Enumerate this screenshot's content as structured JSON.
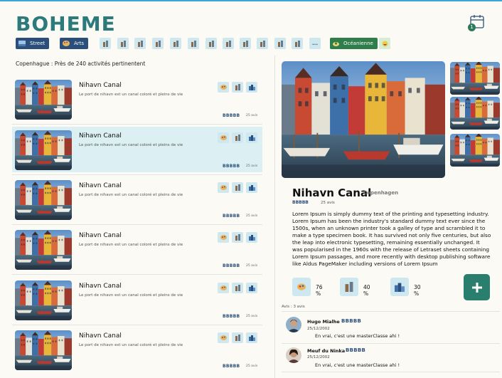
{
  "app": {
    "logo": "BOHEME"
  },
  "header": {
    "calendar_badge": "1"
  },
  "filters": {
    "street_label": "Street",
    "arts_label": "Arts",
    "more_label": "...",
    "oceanienne_label": "Océanienne"
  },
  "results": {
    "title": "Copenhague : Près de 240 activités pertinentent",
    "items": [
      {
        "name": "Nihavn Canal",
        "desc": "Le port de nihavn est un canal coloré et pleins de vie",
        "stars": "BBBBB",
        "reviews": "25 avis"
      },
      {
        "name": "Nihavn Canal",
        "desc": "Le port de nihavn est un canal coloré et pleins de vie",
        "stars": "BBBBB",
        "reviews": "25 avis"
      },
      {
        "name": "Nihavn Canal",
        "desc": "Le port de nihavn est un canal coloré et pleins de vie",
        "stars": "BBBBB",
        "reviews": "25 avis"
      },
      {
        "name": "Nihavn Canal",
        "desc": "Le port de nihavn est un canal coloré et pleins de vie",
        "stars": "BBBBB",
        "reviews": "25 avis"
      },
      {
        "name": "Nihavn Canal",
        "desc": "Le port de nihavn est un canal coloré et pleins de vie",
        "stars": "BBBBB",
        "reviews": "25 avis"
      },
      {
        "name": "Nihavn Canal",
        "desc": "Le port de nihavn est un canal coloré et pleins de vie",
        "stars": "BBBBB",
        "reviews": "25 avis"
      }
    ]
  },
  "detail": {
    "name": "Nihavn Canal",
    "city": "Copenhagen",
    "stars": "BBBBB",
    "reviews": "25 avis",
    "description": "Lorem Ipsum is simply dummy text of the printing and typesetting industry. Lorem Ipsum has been the industry's standard dummy text ever since the 1500s, when an unknown printer took a galley of type and scrambled it to make a type specimen book. It has survived not only five centuries, but also the leap into electronic typesetting, remaining essentially unchanged. It was popularised in the 1960s with the release of Letraset sheets containing Lorem Ipsum passages, and more recently with desktop publishing software like Aldus PageMaker including versions of Lorem Ipsum",
    "stats": [
      {
        "icon": "palette-icon",
        "value": "76 %"
      },
      {
        "icon": "building-icon",
        "value": "40 %"
      },
      {
        "icon": "city-icon",
        "value": "30 %"
      }
    ],
    "avis_label": "Avis : 3 avis"
  },
  "reviews": [
    {
      "name": "Hugo Mialhe",
      "stars": "BBBBB",
      "date": "25/12/2002",
      "text": "En vrai, c'est une masterClasse ahi !"
    },
    {
      "name": "Meuf du Ninka",
      "stars": "BBBBB",
      "date": "25/12/2002",
      "text": "En vrai, c'est une masterClasse ahi !"
    }
  ],
  "colors": {
    "brand": "#2c7a7b",
    "chip_dark": "#2b4f7a",
    "chip_light": "#cfe8f0",
    "selected_row": "#dceff3",
    "add_button": "#2a7e6e"
  }
}
